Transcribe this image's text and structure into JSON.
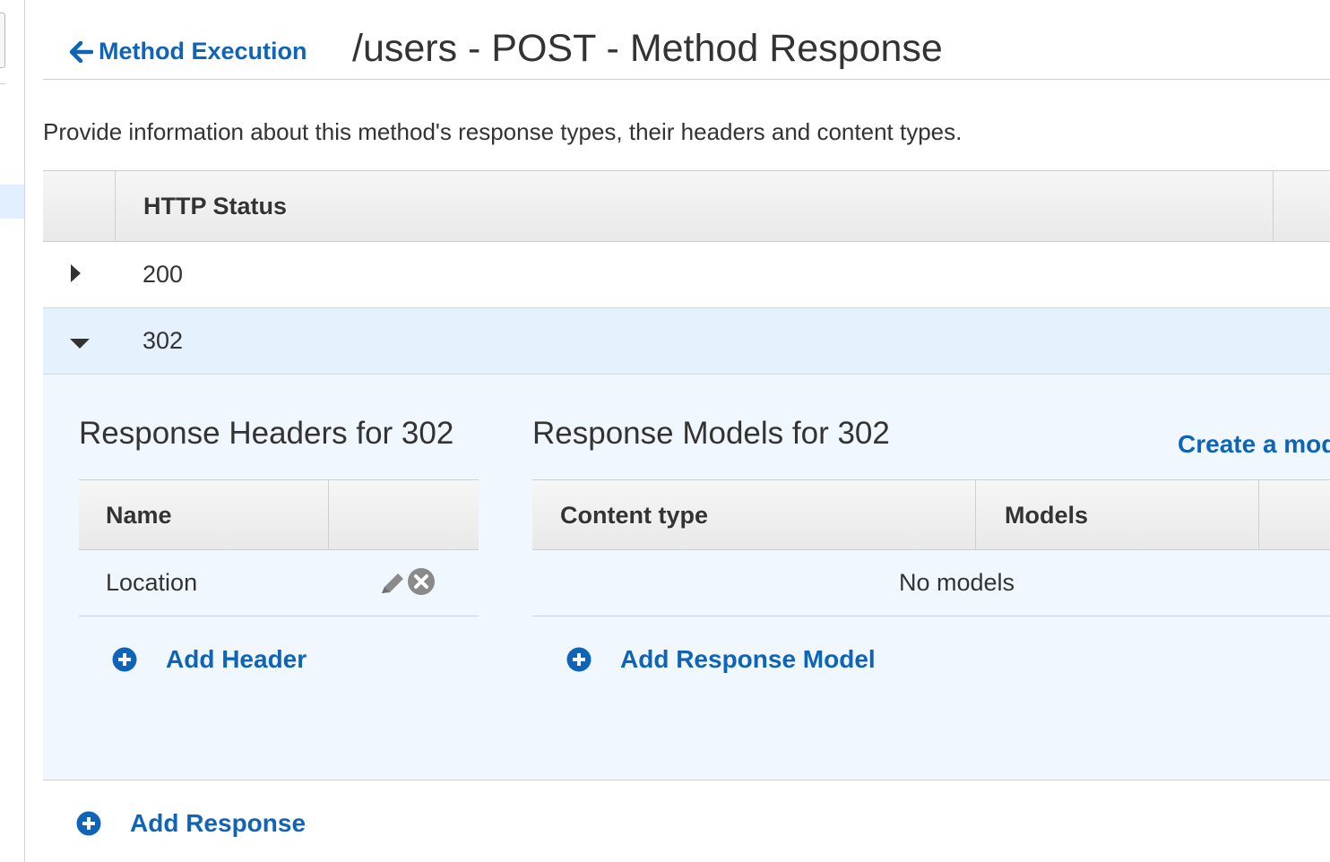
{
  "header": {
    "back_label": "Method Execution",
    "title": "/users - POST - Method Response"
  },
  "description": "Provide information about this method's response types, their headers and content types.",
  "status_table": {
    "column_header": "HTTP Status",
    "rows": [
      {
        "code": "200",
        "expanded": false
      },
      {
        "code": "302",
        "expanded": true
      }
    ]
  },
  "detail": {
    "headers_title": "Response Headers for 302",
    "headers_columns": [
      "Name",
      ""
    ],
    "headers_rows": [
      {
        "name": "Location"
      }
    ],
    "add_header_label": "Add Header",
    "models_title": "Response Models for 302",
    "create_model_label": "Create a model",
    "models_columns": [
      "Content type",
      "Models",
      ""
    ],
    "models_empty": "No models",
    "add_model_label": "Add Response Model"
  },
  "add_response_label": "Add Response",
  "colors": {
    "link": "#0f64b8",
    "expanded_row": "#e5f1fd",
    "panel": "#f0f7fe"
  },
  "icons": [
    "arrow-left-icon",
    "caret-right-icon",
    "caret-down-icon",
    "pencil-icon",
    "remove-circle-icon",
    "plus-circle-icon"
  ]
}
